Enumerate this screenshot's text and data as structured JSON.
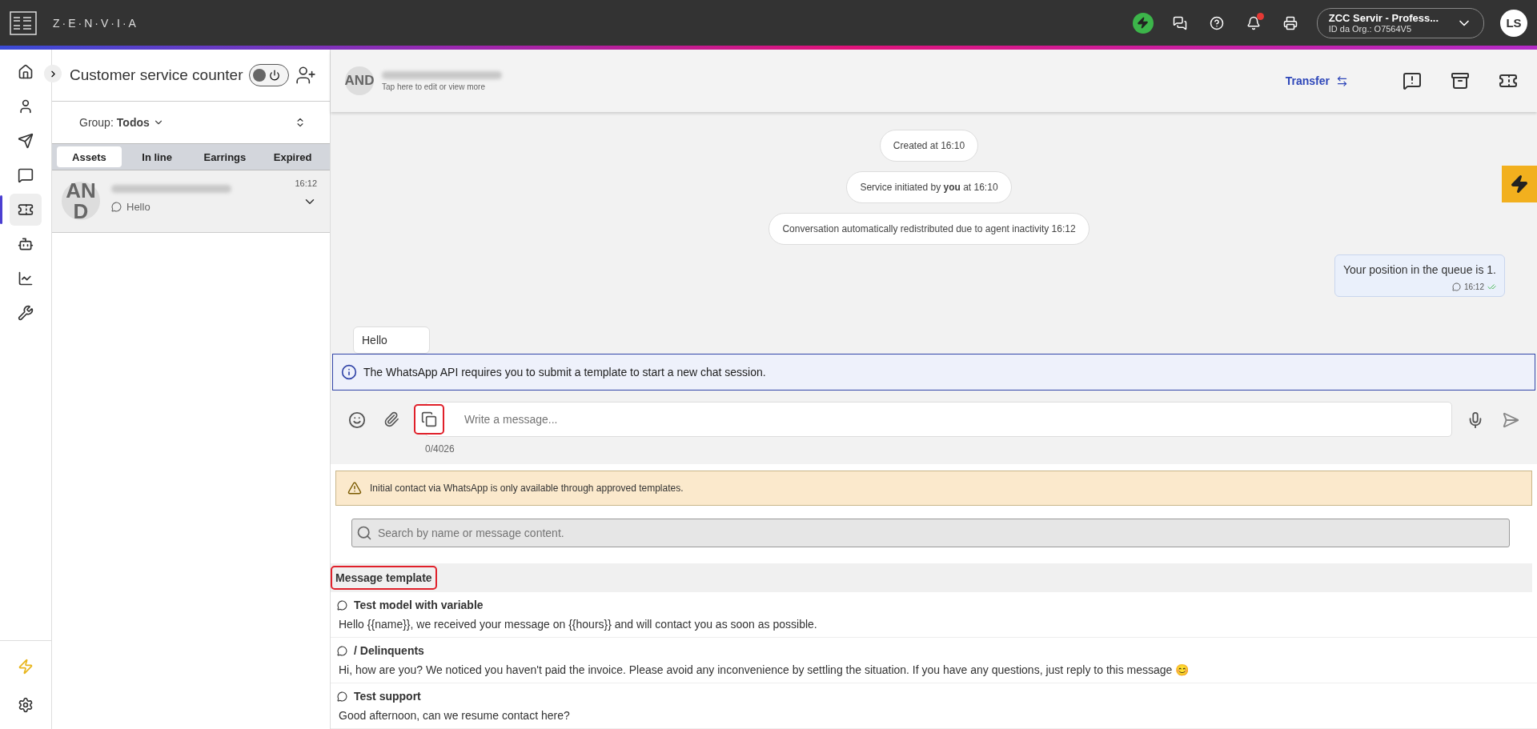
{
  "topbar": {
    "logo": "Z·E·N·V·I·A",
    "status_online": true,
    "notification_alert": true,
    "org": {
      "name": "ZCC Servir - Profess...",
      "id": "ID da Org.: O7564V5"
    },
    "avatar": "LS"
  },
  "nav": [
    {
      "kind": "home",
      "selected": false
    },
    {
      "kind": "contacts",
      "selected": false
    },
    {
      "kind": "send",
      "selected": false
    },
    {
      "kind": "chat",
      "selected": false
    },
    {
      "kind": "ticket",
      "selected": true
    },
    {
      "kind": "bot",
      "selected": false
    },
    {
      "kind": "chart",
      "selected": false
    },
    {
      "kind": "tools",
      "selected": false
    }
  ],
  "panel": {
    "title": "Customer service counter",
    "online": false,
    "group_label": "Group:",
    "group_value": "Todos",
    "tabs": [
      {
        "label": "Assets",
        "selected": true
      },
      {
        "label": "In line",
        "selected": false
      },
      {
        "label": "Earrings",
        "selected": false
      },
      {
        "label": "Expired",
        "selected": false
      }
    ],
    "conversations": [
      {
        "avatar": "AND",
        "time": "16:12",
        "preview": "Hello",
        "selected": true
      }
    ]
  },
  "chat": {
    "avatar": "AND",
    "subtitle": "Tap here to edit or view more",
    "transfer": "Transfer",
    "messages": [
      {
        "kind": "system",
        "text": "Created at 16:10"
      },
      {
        "kind": "system",
        "text": "Service initiated by **you** at 16:10"
      },
      {
        "kind": "system",
        "text": "Conversation automatically redistributed due to agent inactivity 16:12"
      },
      {
        "kind": "outgoing",
        "text": "Your position in the queue is 1.",
        "time": "16:12"
      },
      {
        "kind": "incoming",
        "text": "Hello"
      }
    ],
    "info": "The WhatsApp API requires you to submit a template to start a new chat session.",
    "composer": {
      "placeholder": "Write a message...",
      "counter": "0/4026",
      "template_button_highlighted": true
    },
    "warning": "Initial contact via WhatsApp is only available through approved templates.",
    "template_search": {
      "placeholder": "Search by name or message content."
    },
    "templates": {
      "heading": "Message template",
      "heading_highlighted": true,
      "items": [
        {
          "title": "Test model with variable",
          "body": "Hello {{name}}, we received your message on {{hours}} and will contact you as soon as possible."
        },
        {
          "title": "/ Delinquents",
          "body": "Hi, how are you? We noticed you haven't paid the invoice. Please avoid any inconvenience by settling the situation. If you have any questions, just reply to this message 😊"
        },
        {
          "title": "Test support",
          "body": "Good afternoon, can we resume contact here?"
        }
      ]
    }
  }
}
